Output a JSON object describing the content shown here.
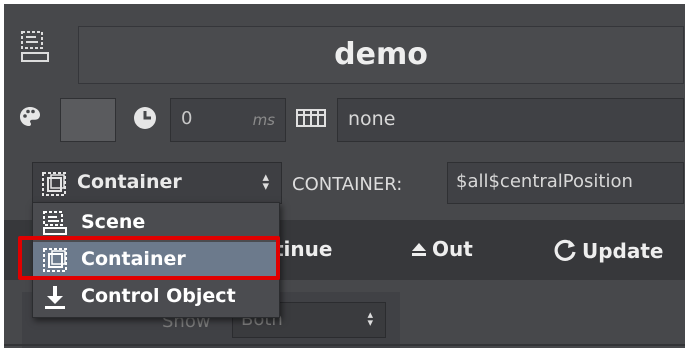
{
  "title": {
    "value": "demo"
  },
  "timing": {
    "duration_value": "0",
    "duration_unit": "ms",
    "color_swatch": "#5a5b5e"
  },
  "timeline": {
    "value": "none"
  },
  "type_select": {
    "selected": "Container",
    "options": [
      {
        "label": "Scene",
        "icon": "scene-icon"
      },
      {
        "label": "Container",
        "icon": "container-icon"
      },
      {
        "label": "Control Object",
        "icon": "download-arrow-icon"
      }
    ]
  },
  "container": {
    "label": "CONTAINER:",
    "value": "$all$centralPosition"
  },
  "toolbar": {
    "continue_label": "tinue",
    "out_label": "Out",
    "update_label": "Update"
  },
  "filter": {
    "show_label": "Show",
    "show_value": "Both"
  },
  "colors": {
    "panel": "#47484b",
    "highlight": "#e00000",
    "selected_row": "#6c7a8c"
  }
}
